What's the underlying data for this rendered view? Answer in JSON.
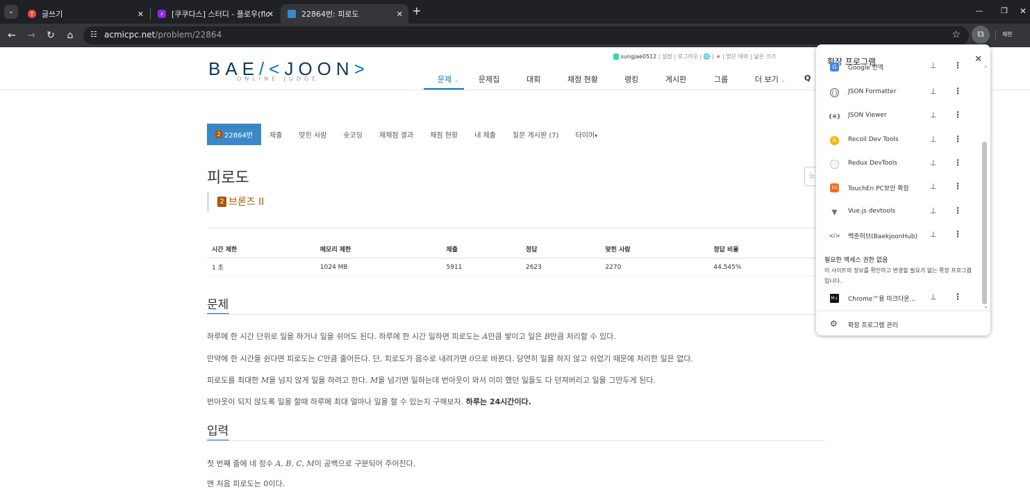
{
  "browser": {
    "tabs": [
      {
        "title": "글쓰기",
        "icon_color": "#e84c3d",
        "icon": "T",
        "active": false
      },
      {
        "title": "[쿠쿠다스] 스터디 - 플로우(flow)",
        "icon_color": "#8a2be2",
        "icon": "lightning-icon",
        "active": false
      },
      {
        "title": "22864번: 피로도",
        "icon_color": "#3a88c7",
        "icon": "",
        "active": true
      }
    ],
    "url_host": "acmicpc.net",
    "url_path": "/problem/22864",
    "profile_label": "제한"
  },
  "site": {
    "logo": "BAEKJOON",
    "logo_sub": "ONLINE JUDGE",
    "user": "sungjae0512",
    "top_links": [
      "설정",
      "로그아웃",
      "밝은 테마",
      "넓은 크기"
    ],
    "menu": [
      "문제",
      "문제집",
      "대회",
      "채점 현황",
      "랭킹",
      "게시판",
      "그룹",
      "더 보기"
    ]
  },
  "problem": {
    "tabs": [
      "22864번",
      "제출",
      "맞힌 사람",
      "숏코딩",
      "재채점 결과",
      "채점 현황",
      "내 제출",
      "질문 게시판 (7)",
      "타이머"
    ],
    "tier_num": "2",
    "title": "피로도",
    "tier": "브론즈 II",
    "table": {
      "headers": [
        "시간 제한",
        "메모리 제한",
        "제출",
        "정답",
        "맞힌 사람",
        "정답 비율"
      ],
      "row": [
        "1 초",
        "1024 MB",
        "5911",
        "2623",
        "2270",
        "44.545%"
      ]
    },
    "section_problem": "문제",
    "desc": {
      "p1a": "하루에 한 시간 단위로 일을 하거나 일을 쉬어도 된다. 하루에 한 시간 일하면 피로도는 ",
      "A": "A",
      "p1b": "만큼 쌓이고 일은 ",
      "B": "B",
      "p1c": "만큼 처리할 수 있다.",
      "p2a": "만약에 한 시간을 쉰다면 피로도는 ",
      "C": "C",
      "p2b": "만큼 줄어든다. 단, 피로도가 음수로 내려가면 ",
      "zero": "0",
      "p2c": "으로 바뀐다. 당연히 일을 하지 않고 쉬었기 때문에 처리한 일은 없다.",
      "p3a": "피로도를 최대한 ",
      "M": "M",
      "p3b": "을 넘지 않게 일을 하려고 한다. ",
      "p3c": "을 넘기면 일하는데 번아웃이 와서 이미 했던 일들도 다 던져버리고 일을 그만두게 된다.",
      "p4a": "번아웃이 되지 않도록 일을 할때 하루에 최대 얼마나 일을 할 수 있는지 구해보자. ",
      "p4b": "하루는 24시간이다."
    },
    "section_input": "입력",
    "input": {
      "p1a": "첫 번째 줄에 네 정수 ",
      "vars": "A, B, C, M",
      "p1b": "이 공백으로 구분되어 주어진다.",
      "p2": "맨 처음 피로도는 0이다."
    }
  },
  "extensions": {
    "title": "확장 프로그램",
    "items": [
      {
        "name": "Google 번역",
        "icon": "translate-icon",
        "color": "#4285f4"
      },
      {
        "name": "JSON Formatter",
        "icon": "braces-icon",
        "color": "#555555"
      },
      {
        "name": "JSON Viewer",
        "icon": "brackets-icon",
        "color": "#555555"
      },
      {
        "name": "Recoil Dev Tools",
        "icon": "recoil-icon",
        "color": "#f5b800"
      },
      {
        "name": "Redux DevTools",
        "icon": "redux-icon",
        "color": "#999999"
      },
      {
        "name": "TouchEn PC보안 확장",
        "icon": "touchen-icon",
        "color": "#f26b21"
      },
      {
        "name": "Vue.js devtools",
        "icon": "vue-icon",
        "color": "#888888"
      },
      {
        "name": "백준허브(BaekjoonHub)",
        "icon": "baekjoonhub-icon",
        "color": "#3a6fb0"
      }
    ],
    "no_access_title": "필요한 액세스 권한 없음",
    "no_access_desc": "이 사이트의 정보를 확인하고 변경할 필요가 없는 확장 프로그램입니다.",
    "no_access_item": {
      "name": "Chrome™용 마크다운...",
      "icon": "markdown-icon",
      "color": "#111111"
    },
    "manage_label": "확장 프로그램 관리"
  }
}
